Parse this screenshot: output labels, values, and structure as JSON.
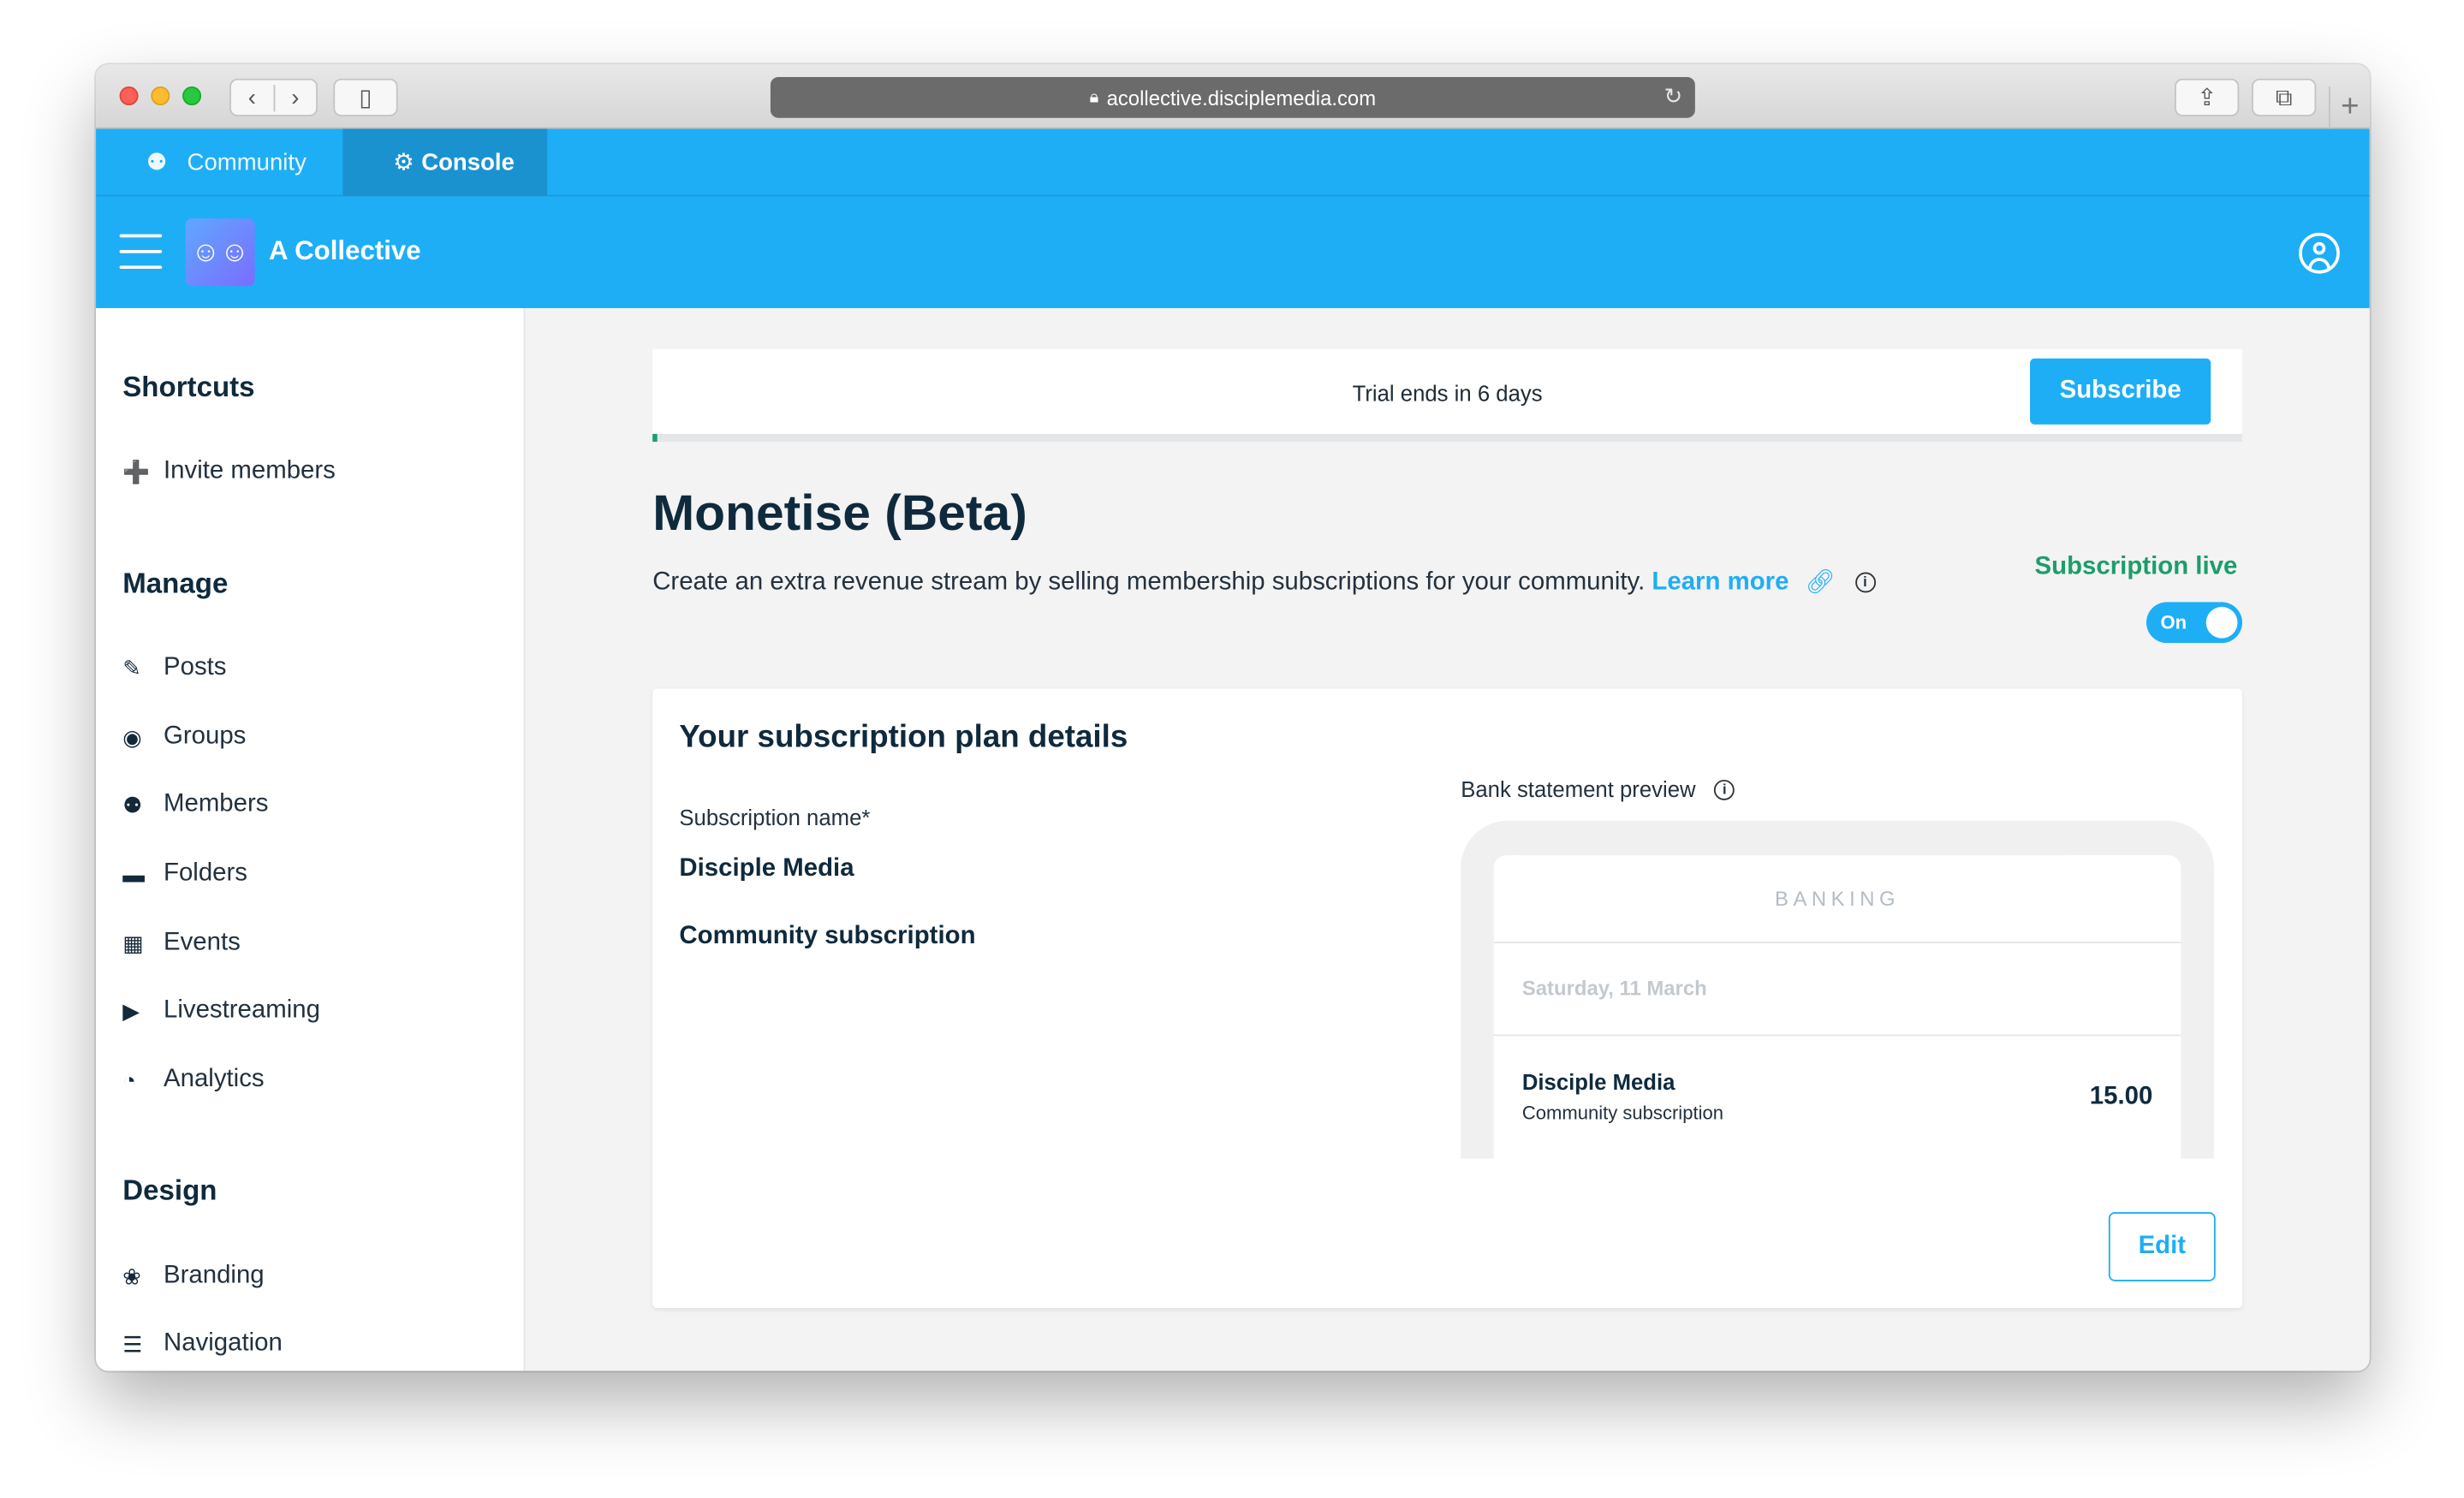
{
  "browser": {
    "url": "acollective.disciplemedia.com",
    "back_icon": "chevron-left-icon",
    "forward_icon": "chevron-right-icon"
  },
  "topnav": {
    "tabs": [
      {
        "label": "Community",
        "icon": "users-icon"
      },
      {
        "label": "Console",
        "icon": "gear-icon"
      }
    ]
  },
  "appbar": {
    "name": "A Collective"
  },
  "sidebar": {
    "shortcuts_title": "Shortcuts",
    "shortcuts": [
      {
        "label": "Invite members",
        "icon": "user-plus-icon"
      }
    ],
    "manage_title": "Manage",
    "manage": [
      {
        "label": "Posts",
        "icon": "edit-icon"
      },
      {
        "label": "Groups",
        "icon": "groups-icon"
      },
      {
        "label": "Members",
        "icon": "members-icon"
      },
      {
        "label": "Folders",
        "icon": "folder-icon"
      },
      {
        "label": "Events",
        "icon": "calendar-icon"
      },
      {
        "label": "Livestreaming",
        "icon": "play-icon"
      },
      {
        "label": "Analytics",
        "icon": "gauge-icon"
      }
    ],
    "design_title": "Design",
    "design": [
      {
        "label": "Branding",
        "icon": "palette-icon"
      },
      {
        "label": "Navigation",
        "icon": "list-icon"
      }
    ]
  },
  "trial": {
    "text": "Trial ends in 6 days",
    "subscribe_label": "Subscribe"
  },
  "monetise": {
    "title": "Monetise (Beta)",
    "description": "Create an extra revenue stream by selling membership subscriptions for your community.",
    "learn_more": "Learn more",
    "live_label": "Subscription live",
    "toggle_label": "On",
    "toggle_on": true
  },
  "plan": {
    "title": "Your subscription plan details",
    "name_label": "Subscription name*",
    "name_value": "Disciple Media",
    "descriptor_value": "Community subscription",
    "preview_label": "Bank statement preview",
    "banking_header": "BANKING",
    "date": "Saturday, 11 March",
    "tx_name": "Disciple Media",
    "tx_desc": "Community subscription",
    "tx_amount": "15.00",
    "edit_label": "Edit"
  },
  "colors": {
    "primary": "#1eaef6",
    "success": "#1d9d6c",
    "text": "#0f2a3d"
  }
}
